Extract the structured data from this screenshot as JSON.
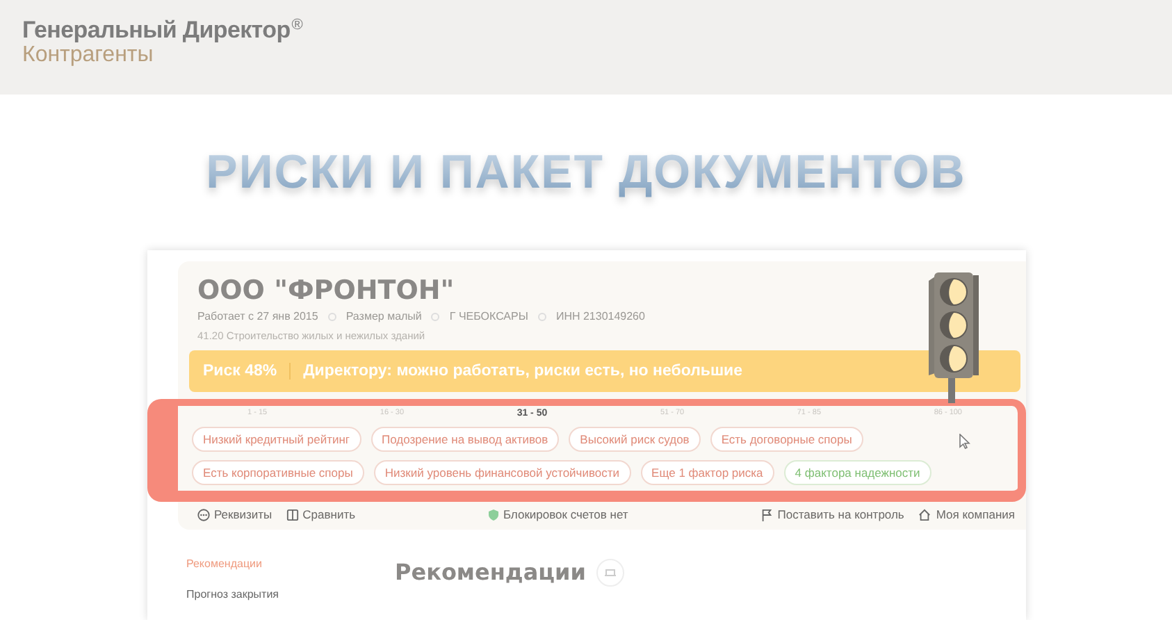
{
  "header": {
    "brand": "Генеральный Директор",
    "brand_mark": "®",
    "product": "Контрагенты"
  },
  "headline": "РИСКИ И ПАКЕТ ДОКУМЕНТОВ",
  "company": {
    "name": "ООО \"ФРОНТОН\"",
    "meta": [
      "Работает с 27 янв 2015",
      "Размер малый",
      "Г ЧЕБОКСАРЫ",
      "ИНН 2130149260"
    ],
    "activity": "41.20 Строительство жилых и нежилых зданий"
  },
  "risk": {
    "score": "Риск 48%",
    "verdict": "Директору: можно работать, риски есть, но небольшие"
  },
  "scale": [
    {
      "label": "1 - 15",
      "selected": false
    },
    {
      "label": "16 - 30",
      "selected": false
    },
    {
      "label": "31 - 50",
      "selected": true
    },
    {
      "label": "51 - 70",
      "selected": false
    },
    {
      "label": "71 - 85",
      "selected": false
    },
    {
      "label": "86 - 100",
      "selected": false
    }
  ],
  "factors": [
    [
      {
        "label": "Низкий кредитный рейтинг",
        "kind": "risk"
      },
      {
        "label": "Подозрение на вывод активов",
        "kind": "risk"
      },
      {
        "label": "Высокий риск судов",
        "kind": "risk"
      },
      {
        "label": "Есть договорные споры",
        "kind": "risk"
      }
    ],
    [
      {
        "label": "Есть корпоративные споры",
        "kind": "risk"
      },
      {
        "label": "Низкий уровень финансовой устойчивости",
        "kind": "risk"
      },
      {
        "label": "Еще 1 фактор риска",
        "kind": "risk"
      },
      {
        "label": "4 фактора надежности",
        "kind": "reliability"
      }
    ]
  ],
  "actions_left": [
    "Реквизиты",
    "Сравнить"
  ],
  "status": "Блокировок счетов нет",
  "actions_right": [
    "Поставить на контроль",
    "Моя компания"
  ],
  "sidebar": [
    {
      "label": "Рекомендации",
      "selected": true
    },
    {
      "label": "Прогноз закрытия",
      "selected": false
    }
  ],
  "section_title": "Рекомендации"
}
